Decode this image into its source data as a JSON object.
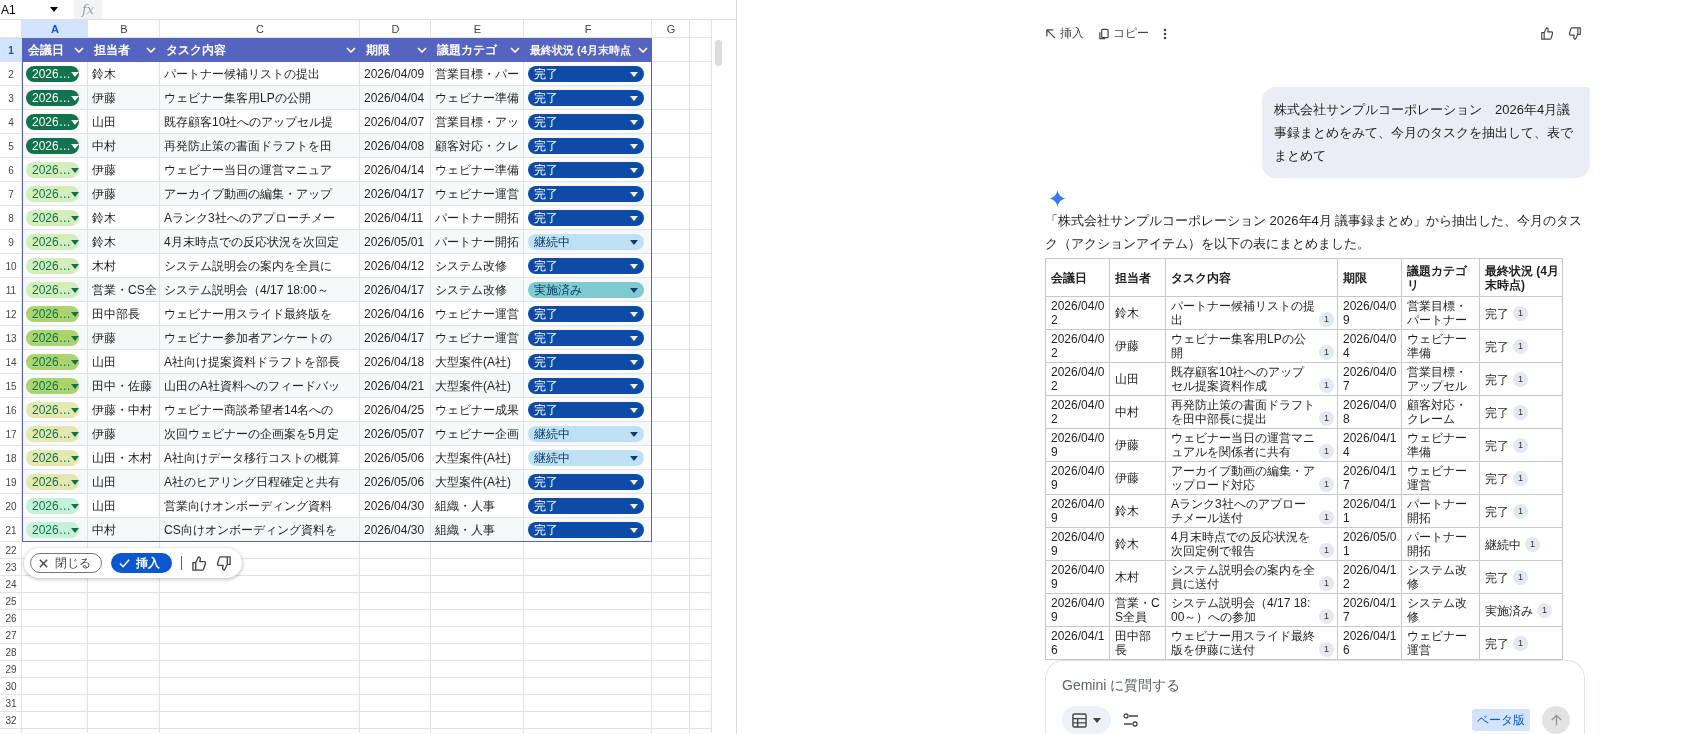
{
  "spreadsheet": {
    "name_box": "A1",
    "formula_label": "fx",
    "columns": [
      {
        "label": "A",
        "selected": true
      },
      {
        "label": "B",
        "selected": false
      },
      {
        "label": "C",
        "selected": false
      },
      {
        "label": "D",
        "selected": false
      },
      {
        "label": "E",
        "selected": false
      },
      {
        "label": "F",
        "selected": false
      },
      {
        "label": "G",
        "selected": false
      }
    ],
    "row_numbers": [
      {
        "label": "1",
        "selected": true
      },
      {
        "label": "2",
        "selected": false
      },
      {
        "label": "3",
        "selected": false
      },
      {
        "label": "4",
        "selected": false
      },
      {
        "label": "5",
        "selected": false
      },
      {
        "label": "6",
        "selected": false
      },
      {
        "label": "7",
        "selected": false
      },
      {
        "label": "8",
        "selected": false
      },
      {
        "label": "9",
        "selected": false
      },
      {
        "label": "10",
        "selected": false
      },
      {
        "label": "11",
        "selected": false
      },
      {
        "label": "12",
        "selected": false
      },
      {
        "label": "13",
        "selected": false
      },
      {
        "label": "14",
        "selected": false
      },
      {
        "label": "15",
        "selected": false
      },
      {
        "label": "16",
        "selected": false
      },
      {
        "label": "17",
        "selected": false
      },
      {
        "label": "18",
        "selected": false
      },
      {
        "label": "19",
        "selected": false
      },
      {
        "label": "20",
        "selected": false
      },
      {
        "label": "21",
        "selected": false
      },
      {
        "label": "22",
        "selected": false
      },
      {
        "label": "23",
        "selected": false
      },
      {
        "label": "24",
        "selected": false
      },
      {
        "label": "25",
        "selected": false
      },
      {
        "label": "26",
        "selected": false
      },
      {
        "label": "27",
        "selected": false
      },
      {
        "label": "28",
        "selected": false
      },
      {
        "label": "29",
        "selected": false
      },
      {
        "label": "30",
        "selected": false
      },
      {
        "label": "31",
        "selected": false
      },
      {
        "label": "32",
        "selected": false
      }
    ],
    "header": [
      "会議日",
      "担当者",
      "タスク内容",
      "期限",
      "議題カテゴ",
      "最終状況 (4月末時点"
    ],
    "rows": [
      {
        "date": {
          "text": "2026…",
          "color": "#11734b"
        },
        "assignee": "鈴木",
        "task": "パートナー候補リストの提出",
        "due": "2026/04/09",
        "category": "営業目標・パー",
        "status": {
          "text": "完了",
          "color": "#0e4ba6"
        }
      },
      {
        "date": {
          "text": "2026…",
          "color": "#11734b"
        },
        "assignee": "伊藤",
        "task": "ウェビナー集客用LPの公開",
        "due": "2026/04/04",
        "category": "ウェビナー準備",
        "status": {
          "text": "完了",
          "color": "#0e4ba6"
        }
      },
      {
        "date": {
          "text": "2026…",
          "color": "#11734b"
        },
        "assignee": "山田",
        "task": "既存顧客10社へのアップセル提",
        "due": "2026/04/07",
        "category": "営業目標・アッ",
        "status": {
          "text": "完了",
          "color": "#0e4ba6"
        }
      },
      {
        "date": {
          "text": "2026…",
          "color": "#11734b"
        },
        "assignee": "中村",
        "task": "再発防止策の書面ドラフトを田",
        "due": "2026/04/08",
        "category": "顧客対応・クレ",
        "status": {
          "text": "完了",
          "color": "#0e4ba6"
        }
      },
      {
        "date": {
          "text": "2026…",
          "color": "#d4edbc"
        },
        "assignee": "伊藤",
        "task": "ウェビナー当日の運営マニュア",
        "due": "2026/04/14",
        "category": "ウェビナー準備",
        "status": {
          "text": "完了",
          "color": "#0e4ba6"
        }
      },
      {
        "date": {
          "text": "2026…",
          "color": "#d4edbc"
        },
        "assignee": "伊藤",
        "task": "アーカイブ動画の編集・アップ",
        "due": "2026/04/17",
        "category": "ウェビナー運営",
        "status": {
          "text": "完了",
          "color": "#0e4ba6"
        }
      },
      {
        "date": {
          "text": "2026…",
          "color": "#d4edbc"
        },
        "assignee": "鈴木",
        "task": "Aランク3社へのアプローチメー",
        "due": "2026/04/11",
        "category": "パートナー開拓",
        "status": {
          "text": "完了",
          "color": "#0e4ba6"
        }
      },
      {
        "date": {
          "text": "2026…",
          "color": "#d4edbc"
        },
        "assignee": "鈴木",
        "task": "4月末時点での反応状況を次回定",
        "due": "2026/05/01",
        "category": "パートナー開拓",
        "status": {
          "text": "継続中",
          "color": "#bfe1f6"
        }
      },
      {
        "date": {
          "text": "2026…",
          "color": "#d4edbc"
        },
        "assignee": "木村",
        "task": "システム説明会の案内を全員に",
        "due": "2026/04/12",
        "category": "システム改修",
        "status": {
          "text": "完了",
          "color": "#0e4ba6"
        }
      },
      {
        "date": {
          "text": "2026…",
          "color": "#d4edbc"
        },
        "assignee": "営業・CS全",
        "task": "システム説明会（4/17 18:00～",
        "due": "2026/04/17",
        "category": "システム改修",
        "status": {
          "text": "実施済み",
          "color": "#7fcbd2"
        }
      },
      {
        "date": {
          "text": "2026…",
          "color": "#a9d46f"
        },
        "assignee": "田中部長",
        "task": "ウェビナー用スライド最終版を",
        "due": "2026/04/16",
        "category": "ウェビナー運営",
        "status": {
          "text": "完了",
          "color": "#0e4ba6"
        }
      },
      {
        "date": {
          "text": "2026…",
          "color": "#a9d46f"
        },
        "assignee": "伊藤",
        "task": "ウェビナー参加者アンケートの",
        "due": "2026/04/17",
        "category": "ウェビナー運営",
        "status": {
          "text": "完了",
          "color": "#0e4ba6"
        }
      },
      {
        "date": {
          "text": "2026…",
          "color": "#a9d46f"
        },
        "assignee": "山田",
        "task": "A社向け提案資料ドラフトを部長",
        "due": "2026/04/18",
        "category": "大型案件(A社)",
        "status": {
          "text": "完了",
          "color": "#0e4ba6"
        }
      },
      {
        "date": {
          "text": "2026…",
          "color": "#a9d46f"
        },
        "assignee": "田中・佐藤",
        "task": "山田のA社資料へのフィードバッ",
        "due": "2026/04/21",
        "category": "大型案件(A社)",
        "status": {
          "text": "完了",
          "color": "#0e4ba6"
        }
      },
      {
        "date": {
          "text": "2026…",
          "color": "#e4e7ae"
        },
        "assignee": "伊藤・中村",
        "task": "ウェビナー商談希望者14名への",
        "due": "2026/04/25",
        "category": "ウェビナー成果",
        "status": {
          "text": "完了",
          "color": "#0e4ba6"
        }
      },
      {
        "date": {
          "text": "2026…",
          "color": "#e4e7ae"
        },
        "assignee": "伊藤",
        "task": "次回ウェビナーの企画案を5月定",
        "due": "2026/05/07",
        "category": "ウェビナー企画",
        "status": {
          "text": "継続中",
          "color": "#bfe1f6"
        }
      },
      {
        "date": {
          "text": "2026…",
          "color": "#e4e7ae"
        },
        "assignee": "山田・木村",
        "task": "A社向けデータ移行コストの概算",
        "due": "2026/05/06",
        "category": "大型案件(A社)",
        "status": {
          "text": "継続中",
          "color": "#bfe1f6"
        }
      },
      {
        "date": {
          "text": "2026…",
          "color": "#e4e7ae"
        },
        "assignee": "山田",
        "task": "A社のヒアリング日程確定と共有",
        "due": "2026/05/06",
        "category": "大型案件(A社)",
        "status": {
          "text": "完了",
          "color": "#0e4ba6"
        }
      },
      {
        "date": {
          "text": "2026…",
          "color": "#c6f1d9"
        },
        "assignee": "山田",
        "task": "営業向けオンボーディング資料",
        "due": "2026/04/30",
        "category": "組織・人事",
        "status": {
          "text": "完了",
          "color": "#0e4ba6"
        }
      },
      {
        "date": {
          "text": "2026…",
          "color": "#c6f1d9"
        },
        "assignee": "中村",
        "task": "CS向けオンボーディング資料を",
        "due": "2026/04/30",
        "category": "組織・人事",
        "status": {
          "text": "完了",
          "color": "#0e4ba6"
        }
      }
    ],
    "toolbar": {
      "close": "閉じる",
      "insert": "挿入"
    }
  },
  "chat": {
    "actions": {
      "insert": "挿入",
      "copy": "コピー"
    },
    "user_message": "株式会社サンプルコーポレーション　2026年4月議事録まとめをみて、今月のタスクを抽出して、表でまとめて",
    "response_intro": "「株式会社サンプルコーポレーション 2026年4月 議事録まとめ」から抽出した、今月のタスク（アクションアイテム）を以下の表にまとめました。",
    "table": {
      "columns": [
        "会議日",
        "担当者",
        "タスク内容",
        "期限",
        "議題カテゴリ",
        "最終状況 (4月末時点)"
      ],
      "rows": [
        {
          "date": "2026/04/02",
          "assignee": "鈴木",
          "task": "パートナー候補リストの提出",
          "task_citation": "1",
          "due": "2026/04/09",
          "category": "営業目標・パートナー",
          "status": "完了",
          "status_citation": "1"
        },
        {
          "date": "2026/04/02",
          "assignee": "伊藤",
          "task": "ウェビナー集客用LPの公開",
          "task_citation": "1",
          "due": "2026/04/04",
          "category": "ウェビナー準備",
          "status": "完了",
          "status_citation": "1"
        },
        {
          "date": "2026/04/02",
          "assignee": "山田",
          "task": "既存顧客10社へのアップセル提案資料作成",
          "task_citation": "1",
          "due": "2026/04/07",
          "category": "営業目標・アップセル",
          "status": "完了",
          "status_citation": "1"
        },
        {
          "date": "2026/04/02",
          "assignee": "中村",
          "task": "再発防止策の書面ドラフトを田中部長に提出",
          "task_citation": "1",
          "due": "2026/04/08",
          "category": "顧客対応・クレーム",
          "status": "完了",
          "status_citation": "1"
        },
        {
          "date": "2026/04/09",
          "assignee": "伊藤",
          "task": "ウェビナー当日の運営マニュアルを関係者に共有",
          "task_citation": "1",
          "due": "2026/04/14",
          "category": "ウェビナー準備",
          "status": "完了",
          "status_citation": "1"
        },
        {
          "date": "2026/04/09",
          "assignee": "伊藤",
          "task": "アーカイブ動画の編集・アップロード対応",
          "task_citation": "1",
          "due": "2026/04/17",
          "category": "ウェビナー運営",
          "status": "完了",
          "status_citation": "1"
        },
        {
          "date": "2026/04/09",
          "assignee": "鈴木",
          "task": "Aランク3社へのアプローチメール送付",
          "task_citation": "1",
          "due": "2026/04/11",
          "category": "パートナー開拓",
          "status": "完了",
          "status_citation": "1"
        },
        {
          "date": "2026/04/09",
          "assignee": "鈴木",
          "task": "4月末時点での反応状況を次回定例で報告",
          "task_citation": "1",
          "due": "2026/05/01",
          "category": "パートナー開拓",
          "status": "継続中",
          "status_citation": "1"
        },
        {
          "date": "2026/04/09",
          "assignee": "木村",
          "task": "システム説明会の案内を全員に送付",
          "task_citation": "1",
          "due": "2026/04/12",
          "category": "システム改修",
          "status": "完了",
          "status_citation": "1"
        },
        {
          "date": "2026/04/09",
          "assignee": "営業・CS全員",
          "task": "システム説明会（4/17 18:00～）への参加",
          "task_citation": "1",
          "due": "2026/04/17",
          "category": "システム改修",
          "status": "実施済み",
          "status_citation": "1"
        },
        {
          "date": "2026/04/16",
          "assignee": "田中部長",
          "task": "ウェビナー用スライド最終版を伊藤に送付",
          "task_citation": "1",
          "due": "2026/04/16",
          "category": "ウェビナー運営",
          "status": "完了",
          "status_citation": "1"
        }
      ]
    },
    "composer": {
      "placeholder": "Gemini に質問する",
      "badge": "ベータ版"
    }
  }
}
